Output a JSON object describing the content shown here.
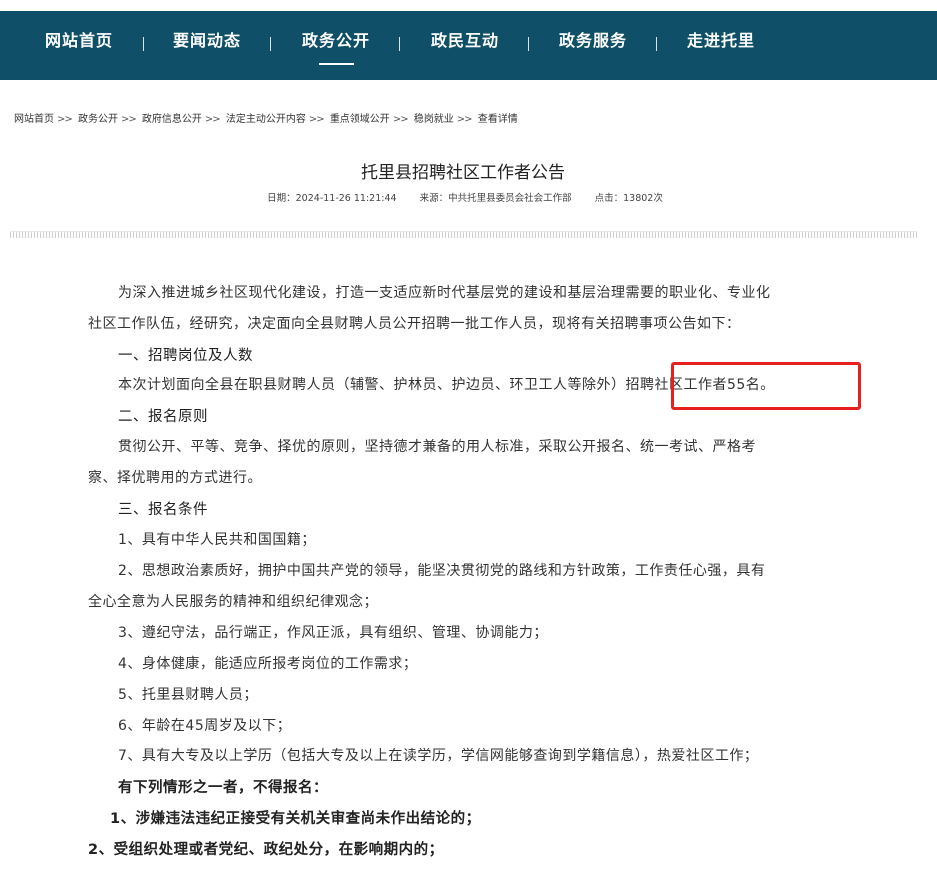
{
  "nav": {
    "items": [
      {
        "label": "网站首页"
      },
      {
        "label": "要闻动态"
      },
      {
        "label": "政务公开"
      },
      {
        "label": "政民互动"
      },
      {
        "label": "政务服务"
      },
      {
        "label": "走进托里"
      }
    ],
    "active": "政务公开"
  },
  "breadcrumb": [
    "网站首页",
    "政务公开",
    "政府信息公开",
    "法定主动公开内容",
    "重点领域公开",
    "稳岗就业",
    "查看详情"
  ],
  "breadcrumb_sep": ">>",
  "article": {
    "title": "托里县招聘社区工作者公告",
    "date": "日期：2024-11-26 11:21:44",
    "source": "来源：中共托里县委员会社会工作部",
    "hits": "点击：13802次",
    "lines": [
      "为深入推进城乡社区现代化建设，打造一支适应新时代基层党的建设和基层治理需要的职业化、专业化",
      "社区工作队伍，经研究，决定面向全县财聘人员公开招聘一批工作人员，现将有关招聘事项公告如下：",
      "一、招聘岗位及人数",
      "本次计划面向全县在职县财聘人员（辅警、护林员、护边员、环卫工人等除外）招聘社区工作者55名。",
      "二、报名原则",
      "贯彻公开、平等、竞争、择优的原则，坚持德才兼备的用人标准，采取公开报名、统一考试、严格考",
      "察、择优聘用的方式进行。",
      "三、报名条件",
      "1、具有中华人民共和国国籍；",
      "2、思想政治素质好，拥护中国共产党的领导，能坚决贯彻党的路线和方针政策，工作责任心强，具有",
      "全心全意为人民服务的精神和组织纪律观念；",
      "3、遵纪守法，品行端正，作风正派，具有组织、管理、协调能力；",
      "4、身体健康，能适应所报考岗位的工作需求；",
      "5、托里县财聘人员；",
      "6、年龄在45周岁及以下；",
      "7、具有大专及以上学历（包括大专及以上在读学历，学信网能够查询到学籍信息），热爱社区工作；",
      "有下列情形之一者，不得报名：",
      "1、涉嫌违法违纪正接受有关机关审查尚未作出结论的；",
      "2、受组织处理或者党纪、政纪处分，在影响期内的；"
    ]
  },
  "colors": {
    "nav_bg": "#0f4f67",
    "highlight_box": "#e5201f"
  }
}
